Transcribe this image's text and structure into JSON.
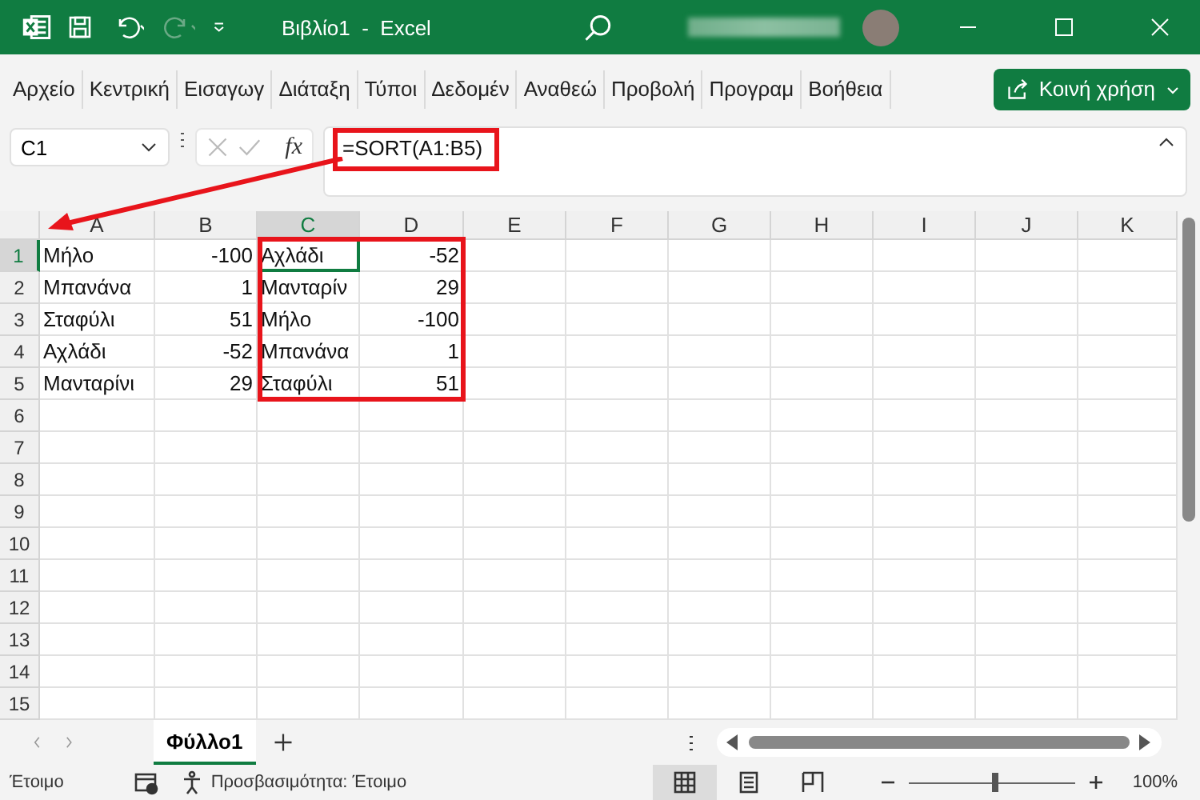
{
  "window": {
    "title": "Βιβλίο1  -  Excel"
  },
  "quick_access": {
    "redo_disabled": true
  },
  "menu": [
    {
      "label": "Αρχείο"
    },
    {
      "label": "Κεντρική"
    },
    {
      "label": "Εισαγωγ"
    },
    {
      "label": "Διάταξη"
    },
    {
      "label": "Τύποι"
    },
    {
      "label": "Δεδομέν"
    },
    {
      "label": "Αναθεώ"
    },
    {
      "label": "Προβολή"
    },
    {
      "label": "Προγραμ"
    },
    {
      "label": "Βοήθεια"
    }
  ],
  "share_button": {
    "label": "Κοινή χρήση"
  },
  "name_box": {
    "value": "C1"
  },
  "formula_bar": {
    "fx": "fx",
    "value": "=SORT(A1:B5)"
  },
  "columns": [
    {
      "letter": "A",
      "selected": false
    },
    {
      "letter": "B",
      "selected": false
    },
    {
      "letter": "C",
      "selected": true
    },
    {
      "letter": "D",
      "selected": false
    },
    {
      "letter": "E",
      "selected": false
    },
    {
      "letter": "F",
      "selected": false
    },
    {
      "letter": "G",
      "selected": false
    },
    {
      "letter": "H",
      "selected": false
    },
    {
      "letter": "I",
      "selected": false
    },
    {
      "letter": "J",
      "selected": false
    },
    {
      "letter": "K",
      "selected": false
    }
  ],
  "rows": [
    {
      "number": "1",
      "selected": true,
      "cells": [
        {
          "text": "Μήλο",
          "kind": "text",
          "selected": false
        },
        {
          "text": "-100",
          "kind": "number",
          "selected": false
        },
        {
          "text": "Αχλάδι",
          "kind": "text",
          "selected": true
        },
        {
          "text": "-52",
          "kind": "number",
          "selected": false
        }
      ]
    },
    {
      "number": "2",
      "selected": false,
      "cells": [
        {
          "text": "Μπανάνα",
          "kind": "text",
          "selected": false
        },
        {
          "text": "1",
          "kind": "number",
          "selected": false
        },
        {
          "text": "Μανταρίν",
          "kind": "text",
          "selected": false
        },
        {
          "text": "29",
          "kind": "number",
          "selected": false
        }
      ]
    },
    {
      "number": "3",
      "selected": false,
      "cells": [
        {
          "text": "Σταφύλι",
          "kind": "text",
          "selected": false
        },
        {
          "text": "51",
          "kind": "number",
          "selected": false
        },
        {
          "text": "Μήλο",
          "kind": "text",
          "selected": false
        },
        {
          "text": "-100",
          "kind": "number",
          "selected": false
        }
      ]
    },
    {
      "number": "4",
      "selected": false,
      "cells": [
        {
          "text": "Αχλάδι",
          "kind": "text",
          "selected": false
        },
        {
          "text": "-52",
          "kind": "number",
          "selected": false
        },
        {
          "text": "Μπανάνα",
          "kind": "text",
          "selected": false
        },
        {
          "text": "1",
          "kind": "number",
          "selected": false
        }
      ]
    },
    {
      "number": "5",
      "selected": false,
      "cells": [
        {
          "text": "Μανταρίνι",
          "kind": "text",
          "selected": false
        },
        {
          "text": "29",
          "kind": "number",
          "selected": false
        },
        {
          "text": "Σταφύλι",
          "kind": "text",
          "selected": false
        },
        {
          "text": "51",
          "kind": "number",
          "selected": false
        }
      ]
    },
    {
      "number": "6",
      "selected": false
    },
    {
      "number": "7",
      "selected": false
    },
    {
      "number": "8",
      "selected": false
    },
    {
      "number": "9",
      "selected": false
    },
    {
      "number": "10",
      "selected": false
    },
    {
      "number": "11",
      "selected": false
    },
    {
      "number": "12",
      "selected": false
    },
    {
      "number": "13",
      "selected": false
    },
    {
      "number": "14",
      "selected": false
    },
    {
      "number": "15",
      "selected": false
    }
  ],
  "sheet_tabs": [
    {
      "label": "Φύλλο1",
      "selected": true
    }
  ],
  "status_bar": {
    "mode": "Έτοιμο",
    "accessibility": "Προσβασιμότητα: Έτοιμο",
    "views": [
      {
        "kind": "normal",
        "selected": true
      },
      {
        "kind": "page-layout",
        "selected": false
      },
      {
        "kind": "page-break",
        "selected": false
      }
    ],
    "zoom": {
      "level": 0.52,
      "reading": "100%"
    }
  }
}
